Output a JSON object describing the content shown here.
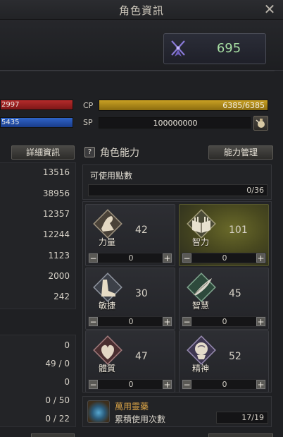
{
  "window": {
    "title": "角色資訊",
    "close_label": "✕"
  },
  "combat_power": {
    "value": "695",
    "icon": "crossed-swords-icon"
  },
  "gauges": {
    "hp_text": "2997",
    "mp_text": "5435",
    "cp_label": "CP",
    "cp_text": "6385/6385",
    "sp_label": "SP",
    "sp_text": "100000000"
  },
  "left_panel": {
    "detail_button": "詳細資訊",
    "stats_values": [
      "13516",
      "38956",
      "12357",
      "12244",
      "1123",
      "2000",
      "242"
    ],
    "sub_values": [
      "0",
      "49 / 0",
      "0",
      "0 / 50",
      "0 / 22"
    ]
  },
  "ability": {
    "help_label": "?",
    "title": "角色能力",
    "manage_button": "能力管理",
    "points_label": "可使用點數",
    "points_value": "0/36",
    "stats": [
      {
        "name": "力量",
        "value": "42",
        "step": "0",
        "icon": "arm-strength-icon"
      },
      {
        "name": "智力",
        "value": "101",
        "step": "0",
        "icon": "open-book-icon"
      },
      {
        "name": "敏捷",
        "value": "30",
        "step": "0",
        "icon": "foot-icon"
      },
      {
        "name": "智慧",
        "value": "45",
        "step": "0",
        "icon": "quill-icon"
      },
      {
        "name": "體質",
        "value": "47",
        "step": "0",
        "icon": "heart-body-icon"
      },
      {
        "name": "精神",
        "value": "52",
        "step": "0",
        "icon": "head-mind-icon"
      }
    ],
    "minus_label": "−",
    "plus_label": "+"
  },
  "elixir": {
    "name": "萬用靈藥",
    "subtitle": "累積使用次數",
    "count": "17/19",
    "icon": "potion-icon"
  }
}
